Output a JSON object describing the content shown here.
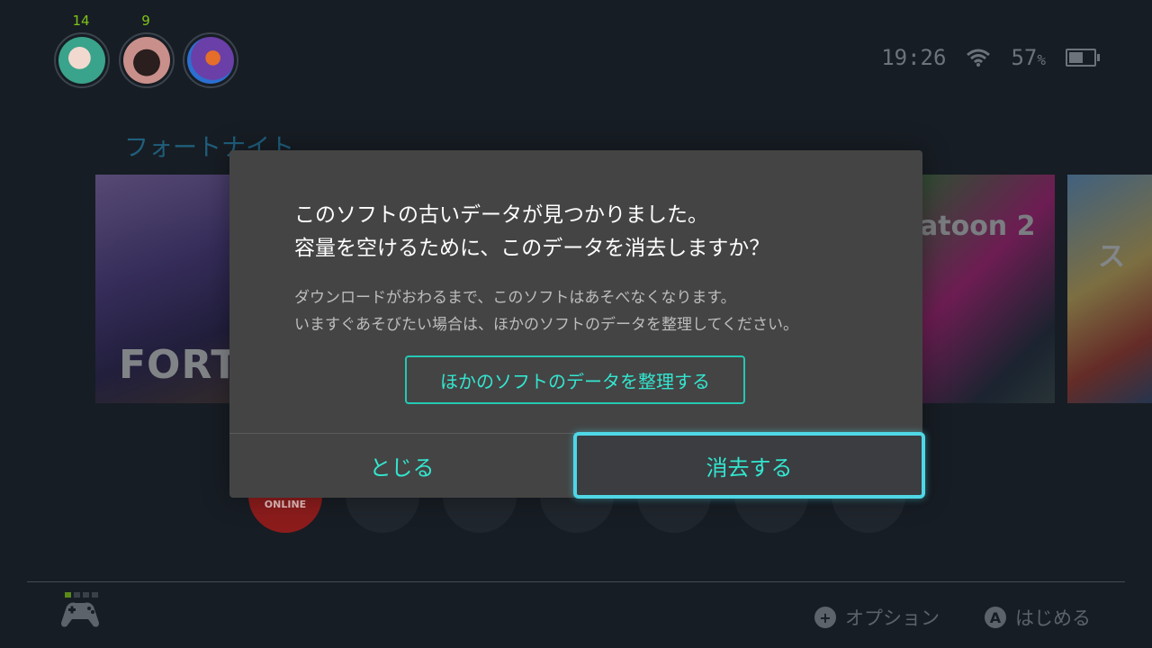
{
  "users": [
    {
      "count": "14"
    },
    {
      "count": "9"
    },
    {
      "count": ""
    }
  ],
  "status": {
    "time": "19:26",
    "battery_value": "57",
    "battery_unit": "%",
    "battery_level": 0.57
  },
  "home": {
    "game_title": "フォートナイト",
    "tiles": [
      {
        "logo": "FORTN"
      },
      {
        "logo": "atoon 2"
      },
      {
        "logo": "ス"
      }
    ],
    "online_label": "ONLINE"
  },
  "dialog": {
    "title_line1": "このソフトの古いデータが見つかりました。",
    "title_line2": "容量を空けるために、このデータを消去しますか？",
    "body_line1": "ダウンロードがおわるまで、このソフトはあそべなくなります。",
    "body_line2": "いますぐあそびたい場合は、ほかのソフトのデータを整理してください。",
    "manage_button": "ほかのソフトのデータを整理する",
    "close_button": "とじる",
    "delete_button": "消去する"
  },
  "footer": {
    "options_glyph": "+",
    "options_label": "オプション",
    "start_glyph": "A",
    "start_label": "はじめる"
  },
  "colors": {
    "accent": "#33e6cf",
    "focus": "#4fd7e6",
    "dialog_bg": "#444444",
    "screen_bg": "#171d24"
  }
}
